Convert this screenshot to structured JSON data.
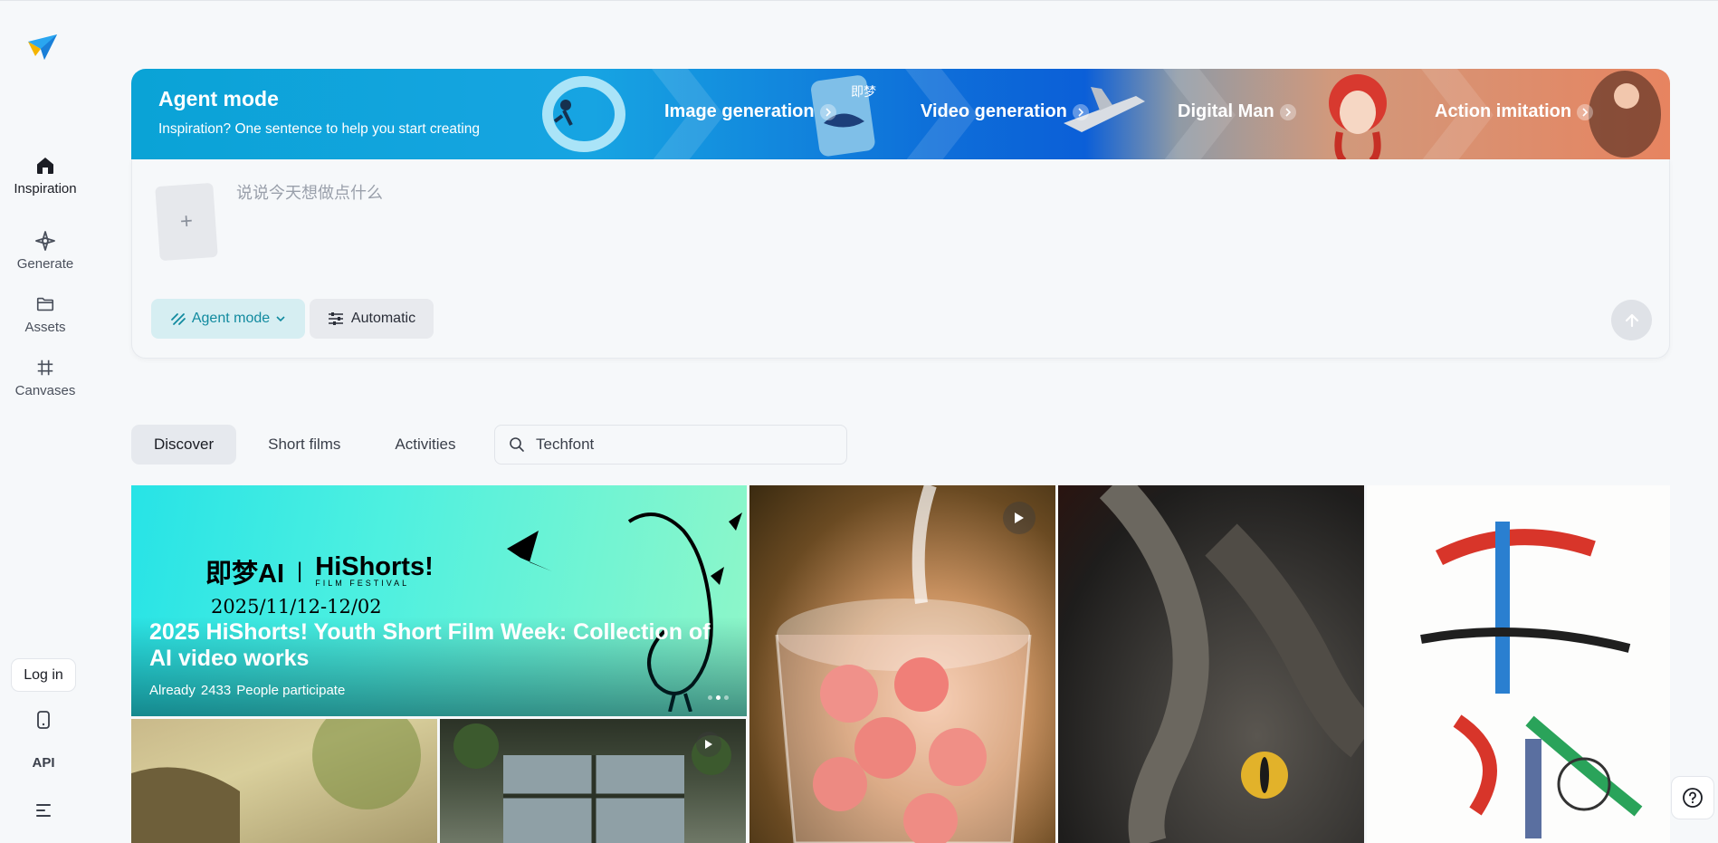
{
  "sidebar": {
    "items": [
      {
        "label": "Inspiration",
        "icon": "home-icon"
      },
      {
        "label": "Generate",
        "icon": "sparkle-icon"
      },
      {
        "label": "Assets",
        "icon": "folder-icon"
      },
      {
        "label": "Canvases",
        "icon": "frame-icon"
      }
    ],
    "login_label": "Log in",
    "api_label": "API"
  },
  "banner": {
    "title": "Agent mode",
    "subtitle": "Inspiration? One sentence to help you start creating",
    "features": [
      "Image generation",
      "Video generation",
      "Digital Man",
      "Action imitation"
    ],
    "overlay_text": "即梦"
  },
  "composer": {
    "placeholder": "说说今天想做点什么",
    "upload_glyph": "+",
    "mode_label": "Agent mode",
    "auto_label": "Automatic"
  },
  "tabs": [
    "Discover",
    "Short films",
    "Activities"
  ],
  "search": {
    "value": "Techfont"
  },
  "hero": {
    "logo_left": "即梦AI",
    "logo_divider": "|",
    "logo_right": "HiShorts!",
    "logo_sub": "FILM FESTIVAL",
    "date": "2025/11/12-12/02",
    "title": "2025 HiShorts! Youth Short Film Week: Collection of AI video works",
    "already": "Already",
    "count": "2433",
    "people": "People participate"
  },
  "colors": {
    "accent": "#118a9f",
    "accent_bg": "#d6eef2",
    "page_bg": "#f6f8fa"
  }
}
